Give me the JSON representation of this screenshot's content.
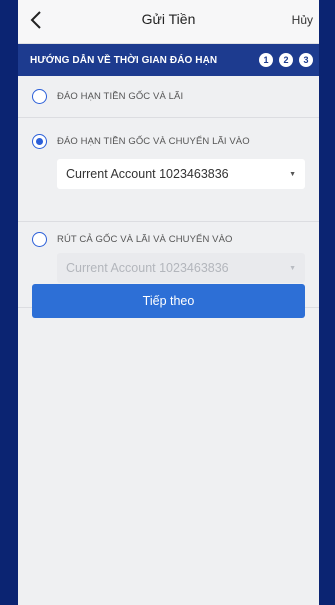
{
  "header": {
    "title": "Gửi Tiền",
    "cancel_label": "Hủy"
  },
  "guide": {
    "title": "HƯỚNG DẪN VỀ THỜI GIAN ĐÁO HẠN",
    "steps": [
      "1",
      "2",
      "3"
    ]
  },
  "options": [
    {
      "label": "ĐÁO HẠN TIỀN GỐC VÀ LÃI",
      "selected": false
    },
    {
      "label": "ĐÁO HẠN TIỀN GỐC VÀ CHUYỂN LÃI VÀO",
      "selected": true,
      "account": "Current Account 1023463836"
    },
    {
      "label": "RÚT CẢ GỐC VÀ LÃI VÀ CHUYỂN VÀO",
      "selected": false,
      "account": "Current Account 1023463836"
    }
  ],
  "actions": {
    "next_label": "Tiếp theo"
  },
  "colors": {
    "frame": "#0b2472",
    "guide_bar": "#1d3b8f",
    "accent": "#2d6fd6"
  }
}
